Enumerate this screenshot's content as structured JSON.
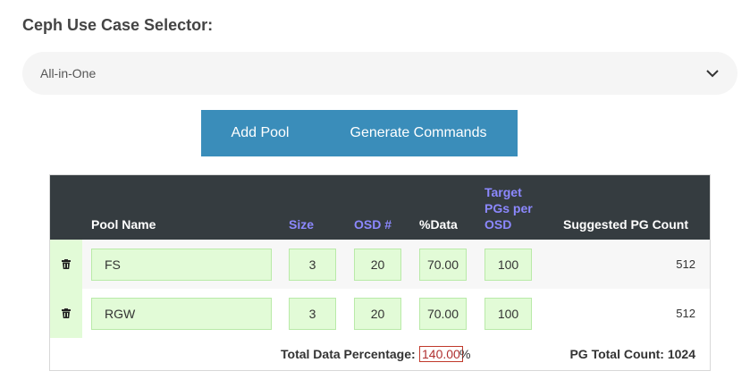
{
  "selector": {
    "label": "Ceph Use Case Selector:",
    "value": "All-in-One"
  },
  "buttons": {
    "add_pool": "Add Pool",
    "generate": "Generate Commands"
  },
  "table": {
    "headers": {
      "pool_name": "Pool Name",
      "size": "Size",
      "osd": "OSD #",
      "data": "%Data",
      "target_line1": "Target",
      "target_line2": "PGs per",
      "target_line3": "OSD",
      "suggested": "Suggested PG Count"
    },
    "rows": [
      {
        "name": "FS",
        "size": "3",
        "osd": "20",
        "data": "70.00",
        "target": "100",
        "pg": "512"
      },
      {
        "name": "RGW",
        "size": "3",
        "osd": "20",
        "data": "70.00",
        "target": "100",
        "pg": "512"
      }
    ],
    "footer": {
      "total_label": "Total Data Percentage:",
      "total_value": "140.00",
      "total_suffix": "%",
      "pg_total_label": "PG Total Count:",
      "pg_total_value": "1024"
    }
  },
  "colors": {
    "header_bg": "#353c40",
    "accent_header": "#8c88ff",
    "button_bg": "#3a8dba",
    "input_bg": "#e2fbd7",
    "error_border": "#c0392b"
  },
  "icons": {
    "dropdown": "chevron-down-icon",
    "delete": "trash-icon"
  }
}
